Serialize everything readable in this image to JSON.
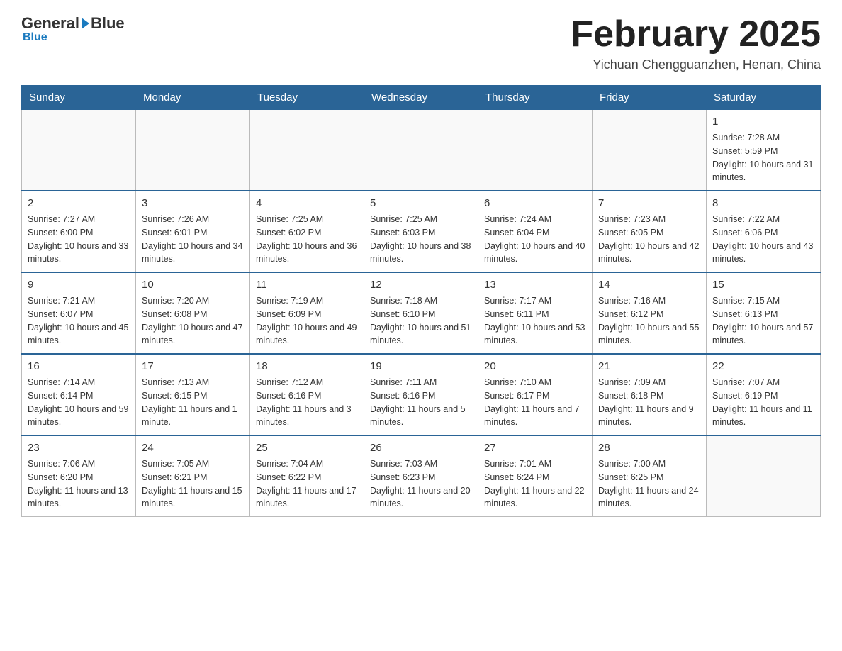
{
  "header": {
    "logo": {
      "general": "General",
      "blue": "Blue"
    },
    "title": "February 2025",
    "location": "Yichuan Chengguanzhen, Henan, China"
  },
  "weekdays": [
    "Sunday",
    "Monday",
    "Tuesday",
    "Wednesday",
    "Thursday",
    "Friday",
    "Saturday"
  ],
  "weeks": [
    [
      {
        "day": "",
        "info": ""
      },
      {
        "day": "",
        "info": ""
      },
      {
        "day": "",
        "info": ""
      },
      {
        "day": "",
        "info": ""
      },
      {
        "day": "",
        "info": ""
      },
      {
        "day": "",
        "info": ""
      },
      {
        "day": "1",
        "info": "Sunrise: 7:28 AM\nSunset: 5:59 PM\nDaylight: 10 hours and 31 minutes."
      }
    ],
    [
      {
        "day": "2",
        "info": "Sunrise: 7:27 AM\nSunset: 6:00 PM\nDaylight: 10 hours and 33 minutes."
      },
      {
        "day": "3",
        "info": "Sunrise: 7:26 AM\nSunset: 6:01 PM\nDaylight: 10 hours and 34 minutes."
      },
      {
        "day": "4",
        "info": "Sunrise: 7:25 AM\nSunset: 6:02 PM\nDaylight: 10 hours and 36 minutes."
      },
      {
        "day": "5",
        "info": "Sunrise: 7:25 AM\nSunset: 6:03 PM\nDaylight: 10 hours and 38 minutes."
      },
      {
        "day": "6",
        "info": "Sunrise: 7:24 AM\nSunset: 6:04 PM\nDaylight: 10 hours and 40 minutes."
      },
      {
        "day": "7",
        "info": "Sunrise: 7:23 AM\nSunset: 6:05 PM\nDaylight: 10 hours and 42 minutes."
      },
      {
        "day": "8",
        "info": "Sunrise: 7:22 AM\nSunset: 6:06 PM\nDaylight: 10 hours and 43 minutes."
      }
    ],
    [
      {
        "day": "9",
        "info": "Sunrise: 7:21 AM\nSunset: 6:07 PM\nDaylight: 10 hours and 45 minutes."
      },
      {
        "day": "10",
        "info": "Sunrise: 7:20 AM\nSunset: 6:08 PM\nDaylight: 10 hours and 47 minutes."
      },
      {
        "day": "11",
        "info": "Sunrise: 7:19 AM\nSunset: 6:09 PM\nDaylight: 10 hours and 49 minutes."
      },
      {
        "day": "12",
        "info": "Sunrise: 7:18 AM\nSunset: 6:10 PM\nDaylight: 10 hours and 51 minutes."
      },
      {
        "day": "13",
        "info": "Sunrise: 7:17 AM\nSunset: 6:11 PM\nDaylight: 10 hours and 53 minutes."
      },
      {
        "day": "14",
        "info": "Sunrise: 7:16 AM\nSunset: 6:12 PM\nDaylight: 10 hours and 55 minutes."
      },
      {
        "day": "15",
        "info": "Sunrise: 7:15 AM\nSunset: 6:13 PM\nDaylight: 10 hours and 57 minutes."
      }
    ],
    [
      {
        "day": "16",
        "info": "Sunrise: 7:14 AM\nSunset: 6:14 PM\nDaylight: 10 hours and 59 minutes."
      },
      {
        "day": "17",
        "info": "Sunrise: 7:13 AM\nSunset: 6:15 PM\nDaylight: 11 hours and 1 minute."
      },
      {
        "day": "18",
        "info": "Sunrise: 7:12 AM\nSunset: 6:16 PM\nDaylight: 11 hours and 3 minutes."
      },
      {
        "day": "19",
        "info": "Sunrise: 7:11 AM\nSunset: 6:16 PM\nDaylight: 11 hours and 5 minutes."
      },
      {
        "day": "20",
        "info": "Sunrise: 7:10 AM\nSunset: 6:17 PM\nDaylight: 11 hours and 7 minutes."
      },
      {
        "day": "21",
        "info": "Sunrise: 7:09 AM\nSunset: 6:18 PM\nDaylight: 11 hours and 9 minutes."
      },
      {
        "day": "22",
        "info": "Sunrise: 7:07 AM\nSunset: 6:19 PM\nDaylight: 11 hours and 11 minutes."
      }
    ],
    [
      {
        "day": "23",
        "info": "Sunrise: 7:06 AM\nSunset: 6:20 PM\nDaylight: 11 hours and 13 minutes."
      },
      {
        "day": "24",
        "info": "Sunrise: 7:05 AM\nSunset: 6:21 PM\nDaylight: 11 hours and 15 minutes."
      },
      {
        "day": "25",
        "info": "Sunrise: 7:04 AM\nSunset: 6:22 PM\nDaylight: 11 hours and 17 minutes."
      },
      {
        "day": "26",
        "info": "Sunrise: 7:03 AM\nSunset: 6:23 PM\nDaylight: 11 hours and 20 minutes."
      },
      {
        "day": "27",
        "info": "Sunrise: 7:01 AM\nSunset: 6:24 PM\nDaylight: 11 hours and 22 minutes."
      },
      {
        "day": "28",
        "info": "Sunrise: 7:00 AM\nSunset: 6:25 PM\nDaylight: 11 hours and 24 minutes."
      },
      {
        "day": "",
        "info": ""
      }
    ]
  ]
}
